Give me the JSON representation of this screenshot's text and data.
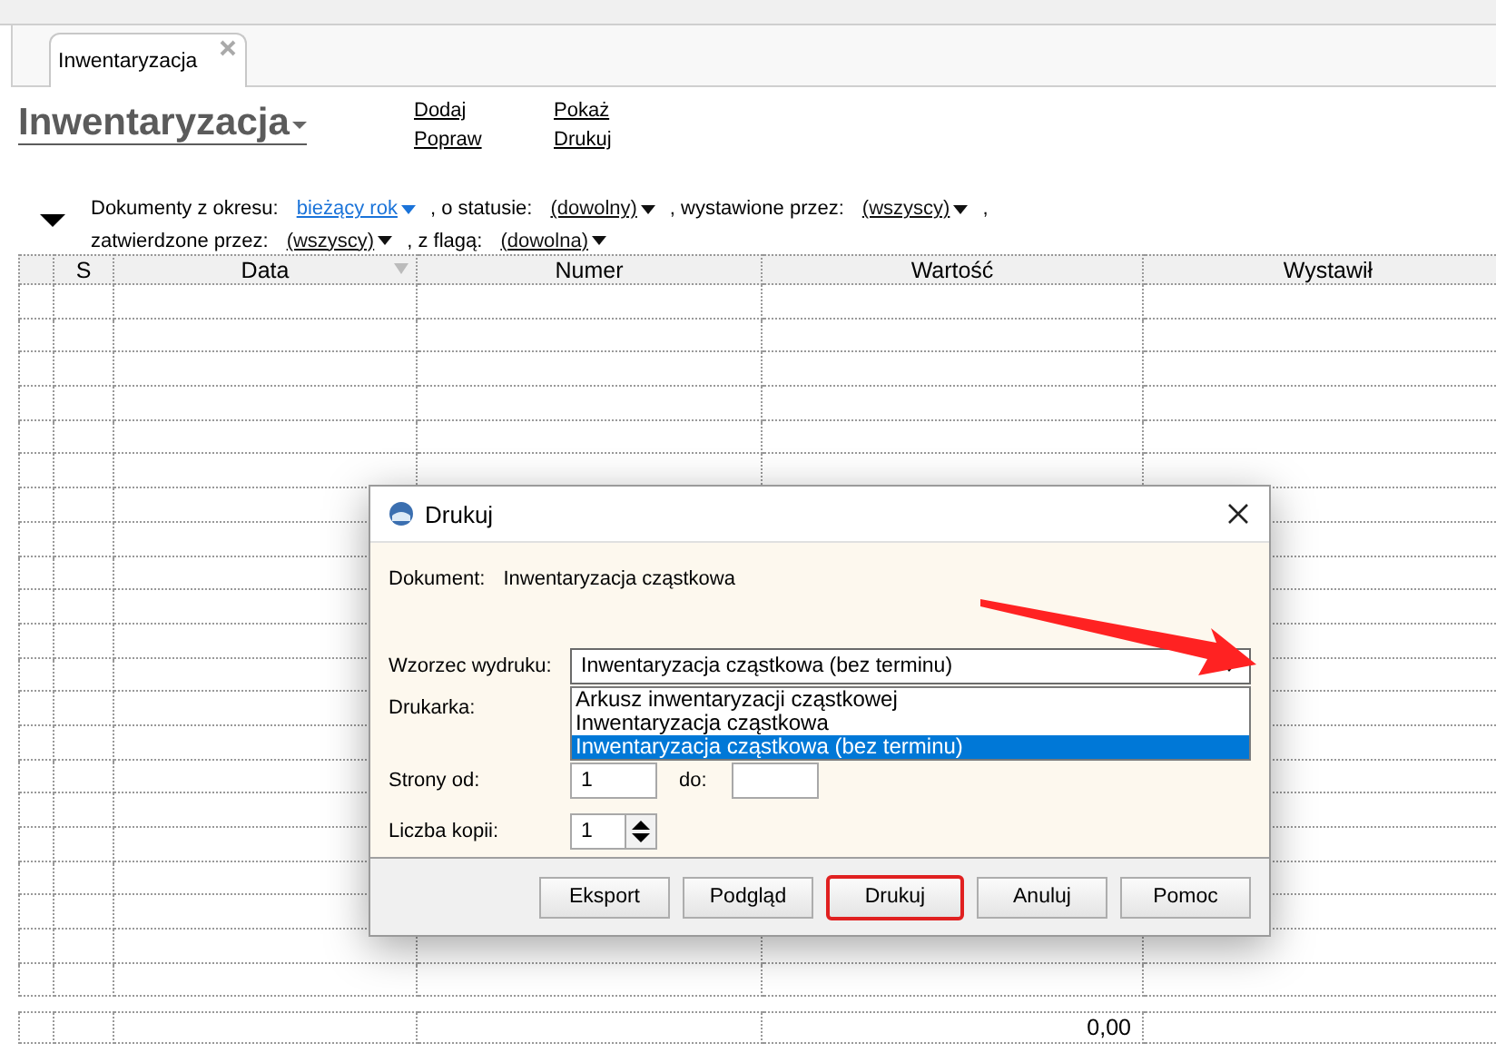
{
  "tabs": [
    {
      "label": "Inwentaryzacja",
      "selected": true
    }
  ],
  "header": {
    "title": "Inwentaryzacja",
    "actions": [
      {
        "label": "Dodaj"
      },
      {
        "label": "Popraw"
      },
      {
        "label": "Pokaż"
      },
      {
        "label": "Drukuj"
      }
    ]
  },
  "filters": {
    "expanded": true,
    "lines": [
      [
        {
          "kind": "label",
          "text": "Dokumenty z okresu:"
        },
        {
          "kind": "dropdown",
          "text": "bieżący rok",
          "active": true
        },
        {
          "kind": "label",
          "text": ", o statusie:"
        },
        {
          "kind": "dropdown",
          "text": "(dowolny)",
          "active": false
        },
        {
          "kind": "label",
          "text": ", wystawione przez:"
        },
        {
          "kind": "dropdown",
          "text": "(wszyscy)",
          "active": false
        },
        {
          "kind": "label",
          "text": ","
        }
      ],
      [
        {
          "kind": "label",
          "text": "zatwierdzone przez:"
        },
        {
          "kind": "dropdown",
          "text": "(wszyscy)",
          "active": false
        },
        {
          "kind": "label",
          "text": ", z flagą:"
        },
        {
          "kind": "dropdown",
          "text": "(dowolna)",
          "active": false
        }
      ]
    ]
  },
  "table": {
    "columns": [
      {
        "label": "S",
        "filter_icon": false
      },
      {
        "label": "Data",
        "filter_icon": true
      },
      {
        "label": "Numer",
        "filter_icon": false
      },
      {
        "label": "Wartość",
        "filter_icon": false
      },
      {
        "label": "Wystawił",
        "filter_icon": false
      }
    ],
    "summary": {
      "value": "0,00"
    }
  },
  "dialog": {
    "title": "Drukuj",
    "document": {
      "label": "Dokument:",
      "value": "Inwentaryzacja cząstkowa"
    },
    "template": {
      "label": "Wzorzec wydruku:",
      "value": "Inwentaryzacja cząstkowa (bez terminu)",
      "expanded": true,
      "options": [
        {
          "label": "Arkusz inwentaryzacji cząstkowej",
          "selected": false
        },
        {
          "label": "Inwentaryzacja cząstkowa",
          "selected": false
        },
        {
          "label": "Inwentaryzacja cząstkowa (bez terminu)",
          "selected": true
        }
      ]
    },
    "printer": {
      "label": "Drukarka:"
    },
    "pages": {
      "from_label": "Strony od:",
      "from_value": "1",
      "to_label": "do:"
    },
    "copies": {
      "label": "Liczba kopii:",
      "value": "1"
    },
    "buttons": [
      {
        "label": "Eksport",
        "highlighted": false
      },
      {
        "label": "Podgląd",
        "highlighted": false
      },
      {
        "label": "Drukuj",
        "highlighted": true
      },
      {
        "label": "Anuluj",
        "highlighted": false
      },
      {
        "label": "Pomoc",
        "highlighted": false
      }
    ]
  }
}
